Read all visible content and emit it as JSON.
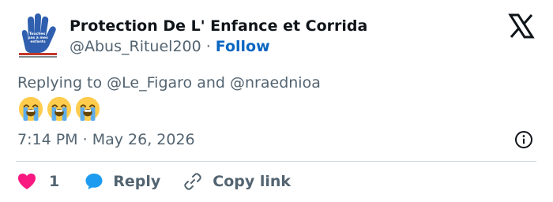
{
  "author": {
    "display_name": "Protection De L' Enfance et Corrida",
    "handle": "@Abus_Rituel200",
    "separator": "·",
    "follow_label": "Follow",
    "avatar_text": [
      "Touches",
      "pas à mes",
      "enfants"
    ]
  },
  "tweet": {
    "replying_prefix": "Replying to",
    "reply_mention_1": "@Le_Figaro",
    "reply_and": "and",
    "reply_mention_2": "@nraednioa",
    "emoji_count": 3,
    "emoji_name": "loudly-crying-face"
  },
  "meta": {
    "time": "7:14 PM",
    "separator": "·",
    "date": "May 26, 2026"
  },
  "actions": {
    "like_count": "1",
    "reply_label": "Reply",
    "copy_label": "Copy link"
  },
  "colors": {
    "text_primary": "#0f1419",
    "text_secondary": "#536471",
    "follow_blue": "#0a66c2",
    "like_red": "#f91880",
    "reply_blue": "#1d9bf0",
    "divider": "#cfd9de"
  },
  "icons": [
    "x-logo-icon",
    "info-icon",
    "heart-icon",
    "reply-bubble-icon",
    "link-icon"
  ]
}
